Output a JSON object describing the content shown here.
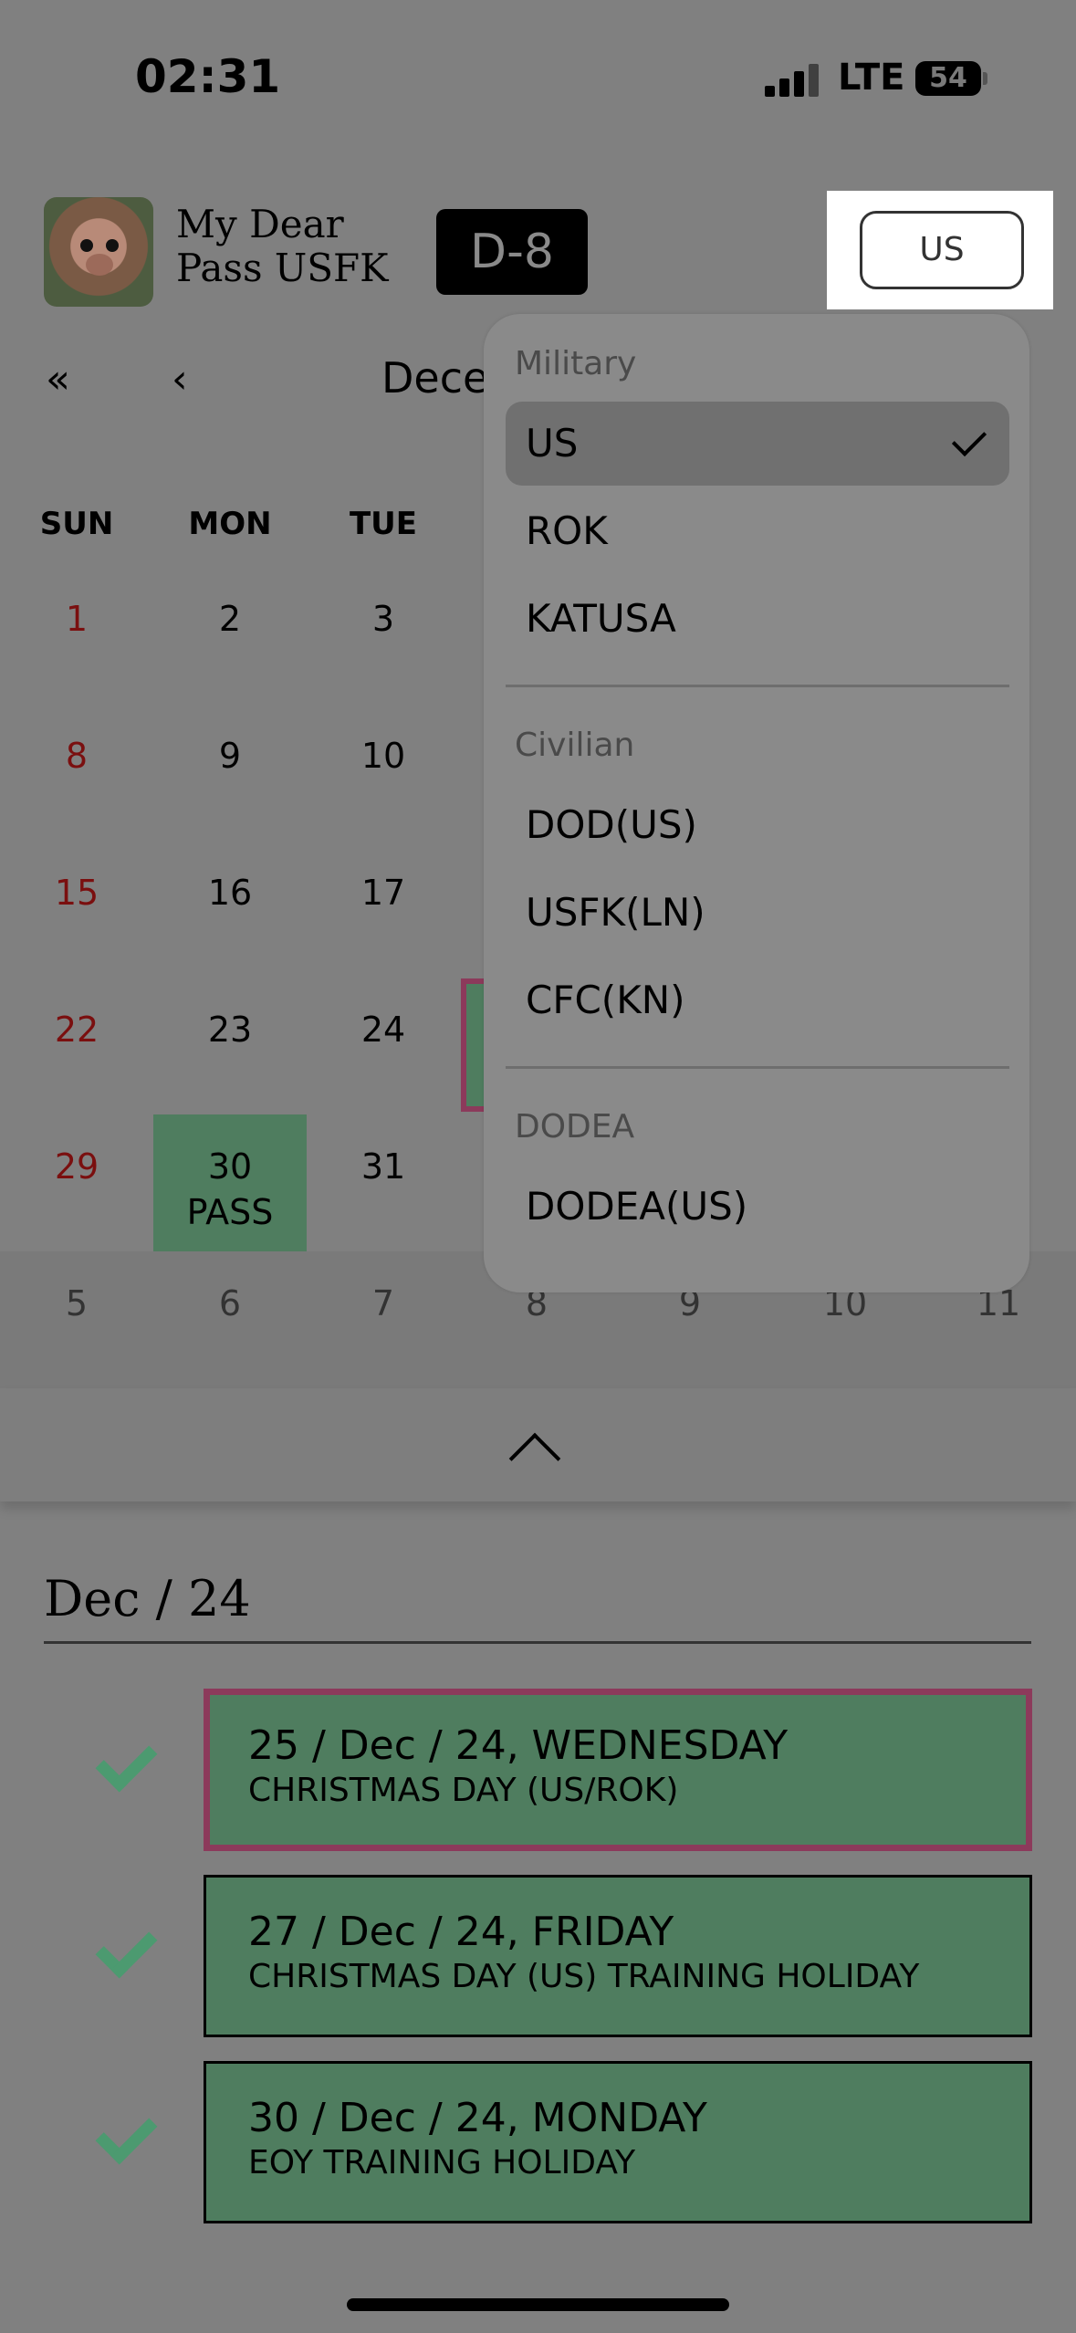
{
  "status_bar": {
    "time": "02:31",
    "network": "LTE",
    "battery": "54"
  },
  "header": {
    "app_title_line1": "My Dear",
    "app_title_line2": "Pass USFK",
    "dday": "D-8",
    "selector_value": "US"
  },
  "calendar": {
    "nav_first": "«",
    "nav_prev": "‹",
    "month_label": "Dece",
    "weekdays": [
      "SUN",
      "MON",
      "TUE"
    ],
    "rows": [
      [
        "1",
        "2",
        "3"
      ],
      [
        "8",
        "9",
        "10"
      ],
      [
        "15",
        "16",
        "17"
      ],
      [
        "22",
        "23",
        "24"
      ],
      [
        "29",
        "30",
        "31"
      ]
    ],
    "pass_label": "PASS",
    "next_month_row": [
      "5",
      "6",
      "7",
      "8",
      "9",
      "10",
      "11"
    ]
  },
  "menu": {
    "sections": [
      {
        "heading": "Military",
        "items": [
          "US",
          "ROK",
          "KATUSA"
        ]
      },
      {
        "heading": "Civilian",
        "items": [
          "DOD(US)",
          "USFK(LN)",
          "CFC(KN)"
        ]
      },
      {
        "heading": "DODEA",
        "items": [
          "DODEA(US)"
        ]
      }
    ],
    "selected": "US"
  },
  "holidays": {
    "section_title": "Dec / 24",
    "items": [
      {
        "date": "25 / Dec / 24, WEDNESDAY",
        "desc": "CHRISTMAS DAY (US/ROK)",
        "highlighted": true
      },
      {
        "date": "27 / Dec / 24, FRIDAY",
        "desc": "CHRISTMAS DAY (US) TRAINING HOLIDAY",
        "highlighted": false
      },
      {
        "date": "30 / Dec / 24, MONDAY",
        "desc": "EOY TRAINING HOLIDAY",
        "highlighted": false
      }
    ]
  },
  "colors": {
    "overlay_bg": "#808080",
    "pass_green": "#4f7d5f",
    "highlight_border": "#8c3a5b",
    "check_green": "#4c9a70",
    "sunday_red": "#7a0f0f"
  }
}
